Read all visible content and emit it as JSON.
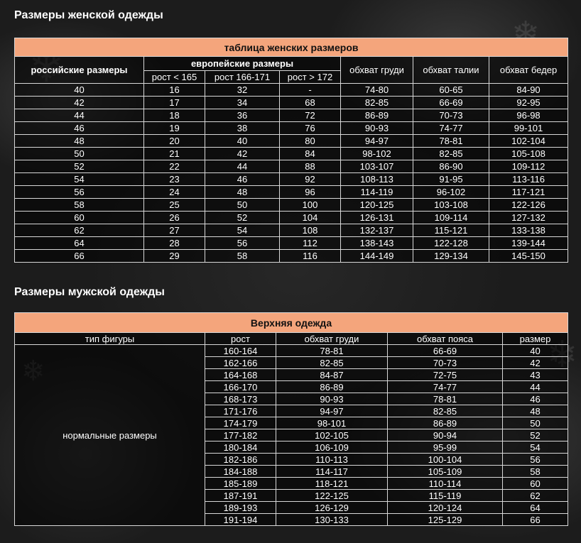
{
  "women": {
    "heading": "Размеры женской одежды",
    "caption": "таблица женских размеров",
    "headers": {
      "russian": "российские размеры",
      "european": "европейские размеры",
      "heights": [
        "рост < 165",
        "рост 166-171",
        "рост > 172"
      ],
      "chest": "обхват груди",
      "waist": "обхват талии",
      "hips": "обхват бедер"
    },
    "rows": [
      [
        "40",
        "16",
        "32",
        "-",
        "74-80",
        "60-65",
        "84-90"
      ],
      [
        "42",
        "17",
        "34",
        "68",
        "82-85",
        "66-69",
        "92-95"
      ],
      [
        "44",
        "18",
        "36",
        "72",
        "86-89",
        "70-73",
        "96-98"
      ],
      [
        "46",
        "19",
        "38",
        "76",
        "90-93",
        "74-77",
        "99-101"
      ],
      [
        "48",
        "20",
        "40",
        "80",
        "94-97",
        "78-81",
        "102-104"
      ],
      [
        "50",
        "21",
        "42",
        "84",
        "98-102",
        "82-85",
        "105-108"
      ],
      [
        "52",
        "22",
        "44",
        "88",
        "103-107",
        "86-90",
        "109-112"
      ],
      [
        "54",
        "23",
        "46",
        "92",
        "108-113",
        "91-95",
        "113-116"
      ],
      [
        "56",
        "24",
        "48",
        "96",
        "114-119",
        "96-102",
        "117-121"
      ],
      [
        "58",
        "25",
        "50",
        "100",
        "120-125",
        "103-108",
        "122-126"
      ],
      [
        "60",
        "26",
        "52",
        "104",
        "126-131",
        "109-114",
        "127-132"
      ],
      [
        "62",
        "27",
        "54",
        "108",
        "132-137",
        "115-121",
        "133-138"
      ],
      [
        "64",
        "28",
        "56",
        "112",
        "138-143",
        "122-128",
        "139-144"
      ],
      [
        "66",
        "29",
        "58",
        "116",
        "144-149",
        "129-134",
        "145-150"
      ]
    ]
  },
  "men": {
    "heading": "Размеры мужской одежды",
    "caption": "Верхняя одежда",
    "headers": {
      "figure": "тип фигуры",
      "height": "рост",
      "chest": "обхват груди",
      "waist": "обхват пояса",
      "size": "размер"
    },
    "figure_type": "нормальные размеры",
    "rows": [
      [
        "160-164",
        "78-81",
        "66-69",
        "40"
      ],
      [
        "162-166",
        "82-85",
        "70-73",
        "42"
      ],
      [
        "164-168",
        "84-87",
        "72-75",
        "43"
      ],
      [
        "166-170",
        "86-89",
        "74-77",
        "44"
      ],
      [
        "168-173",
        "90-93",
        "78-81",
        "46"
      ],
      [
        "171-176",
        "94-97",
        "82-85",
        "48"
      ],
      [
        "174-179",
        "98-101",
        "86-89",
        "50"
      ],
      [
        "177-182",
        "102-105",
        "90-94",
        "52"
      ],
      [
        "180-184",
        "106-109",
        "95-99",
        "54"
      ],
      [
        "182-186",
        "110-113",
        "100-104",
        "56"
      ],
      [
        "184-188",
        "114-117",
        "105-109",
        "58"
      ],
      [
        "185-189",
        "118-121",
        "110-114",
        "60"
      ],
      [
        "187-191",
        "122-125",
        "115-119",
        "62"
      ],
      [
        "189-193",
        "126-129",
        "120-124",
        "64"
      ],
      [
        "191-194",
        "130-133",
        "125-129",
        "66"
      ]
    ]
  },
  "colors": {
    "caption_bg": "#f4a57c",
    "page_bg": "#1c1c1c",
    "border": "#d8d8d8"
  }
}
